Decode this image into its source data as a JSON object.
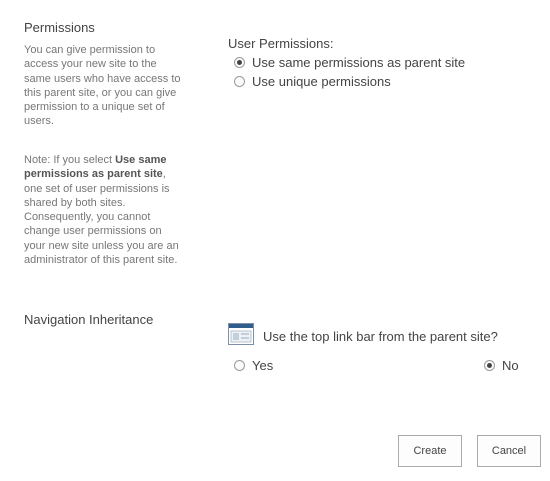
{
  "permissions": {
    "title": "Permissions",
    "description": "You can give permission to access your new site to the same users who have access to this parent site, or you can give permission to a unique set of users.",
    "note_prefix": "Note: If you select ",
    "note_bold": "Use same permissions as parent site",
    "note_suffix": ", one set of user permissions is shared by both sites. Consequently, you cannot change user permissions on your new site unless you are an administrator of this parent site.",
    "field_label": "User Permissions:",
    "options": [
      {
        "label": "Use same permissions as parent site",
        "selected": true
      },
      {
        "label": "Use unique permissions",
        "selected": false
      }
    ]
  },
  "navigation": {
    "title": "Navigation Inheritance",
    "question": "Use the top link bar from the parent site?",
    "icon": "top-link-bar-icon",
    "options": [
      {
        "label": "Yes",
        "selected": false
      },
      {
        "label": "No",
        "selected": true
      }
    ]
  },
  "buttons": {
    "create": "Create",
    "cancel": "Cancel"
  }
}
